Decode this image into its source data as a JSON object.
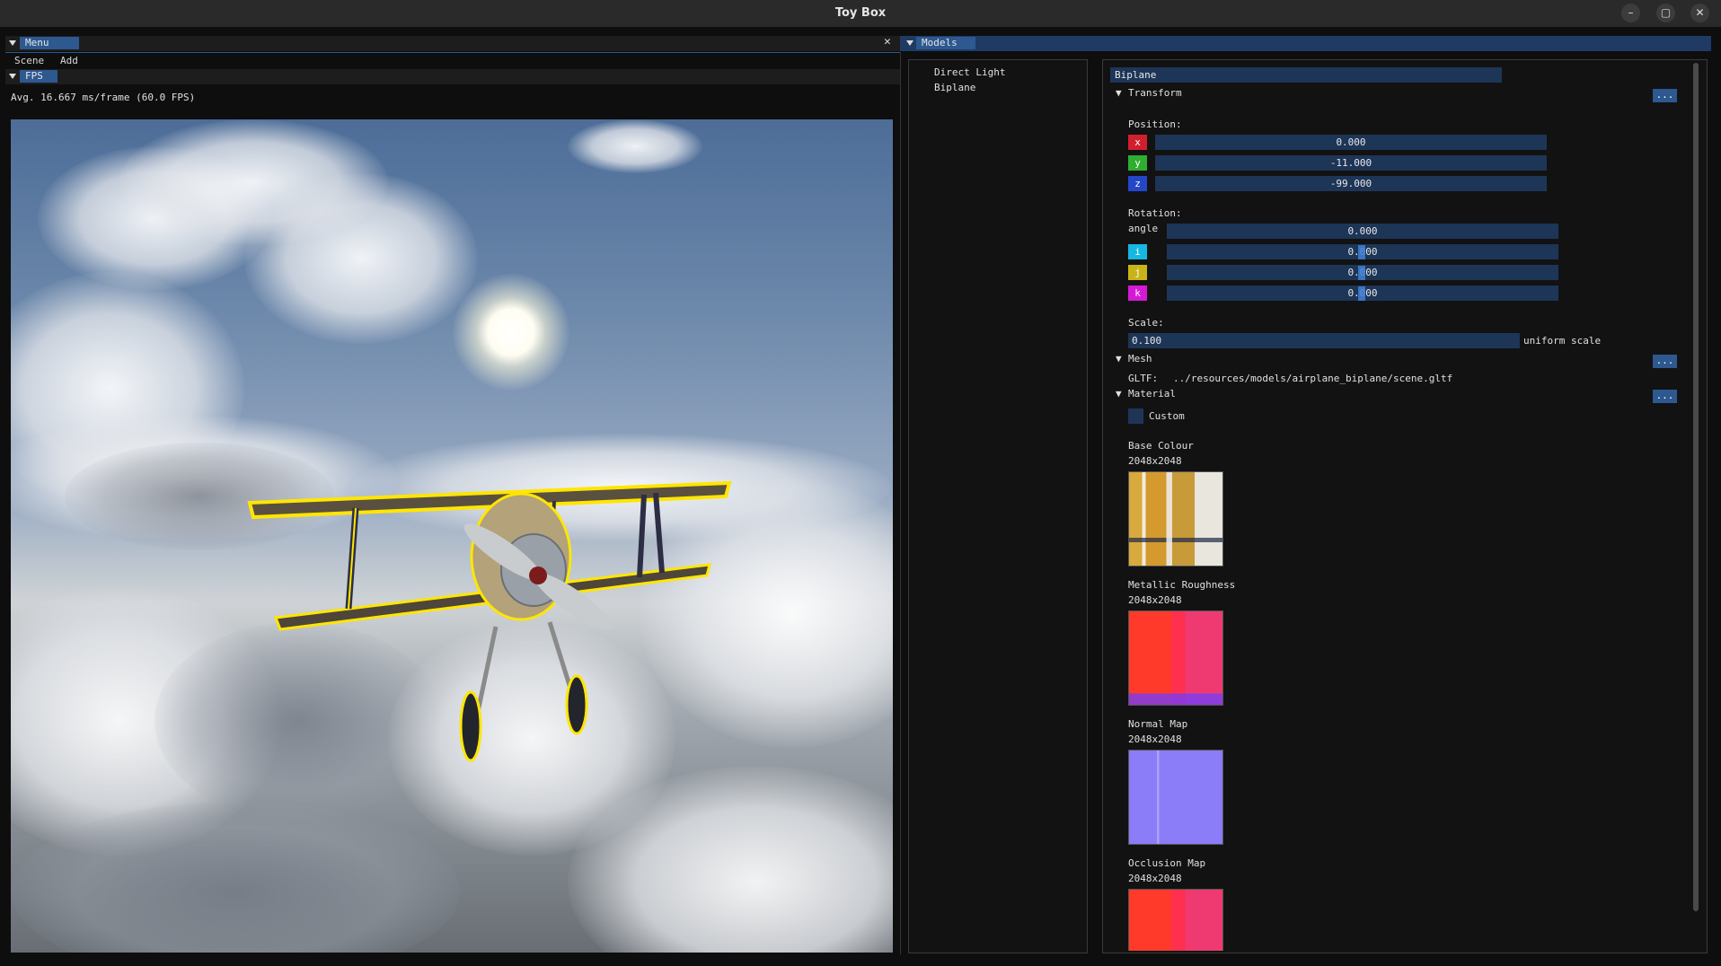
{
  "window": {
    "title": "Toy Box"
  },
  "menu_window": {
    "tab": "Menu",
    "items": [
      "Scene",
      "Add"
    ]
  },
  "fps_window": {
    "tab": "FPS",
    "text": "Avg. 16.667 ms/frame (60.0 FPS)"
  },
  "models_window": {
    "tab": "Models",
    "list": [
      "Direct Light",
      "Biplane"
    ],
    "name_value": "Biplane",
    "transform": {
      "header": "Transform",
      "dots": "...",
      "position_label": "Position:",
      "position": [
        {
          "axis": "x",
          "value": "0.000",
          "color": "#d0202e"
        },
        {
          "axis": "y",
          "value": "-11.000",
          "color": "#2fae2f"
        },
        {
          "axis": "z",
          "value": "-99.000",
          "color": "#2447c8"
        }
      ],
      "rotation_label": "Rotation:",
      "angle_label": "angle",
      "angle_value": "0.000",
      "rotation": [
        {
          "axis": "i",
          "value": "0.000",
          "color": "#15b8e0"
        },
        {
          "axis": "j",
          "value": "0.000",
          "color": "#c8b418"
        },
        {
          "axis": "k",
          "value": "0.000",
          "color": "#d41ad4"
        }
      ],
      "scale_label": "Scale:",
      "scale_value": "0.100",
      "uniform_label": "uniform scale"
    },
    "mesh": {
      "header": "Mesh",
      "dots": "...",
      "gltf_label": "GLTF:",
      "gltf_path": "../resources/models/airplane_biplane/scene.gltf"
    },
    "material": {
      "header": "Material",
      "dots": "...",
      "custom_label": "Custom",
      "textures": [
        {
          "name": "Base Colour",
          "size": "2048x2048"
        },
        {
          "name": "Metallic Roughness",
          "size": "2048x2048"
        },
        {
          "name": "Normal Map",
          "size": "2048x2048"
        },
        {
          "name": "Occlusion Map",
          "size": "2048x2048"
        }
      ]
    }
  },
  "icons": {
    "collapse": "triangle-down-icon",
    "close": "close-icon",
    "minimize": "minimize-icon",
    "maximize": "maximize-icon"
  },
  "colors": {
    "accent": "#2d5890",
    "field": "#1d3557",
    "outline": "#ffe600"
  }
}
